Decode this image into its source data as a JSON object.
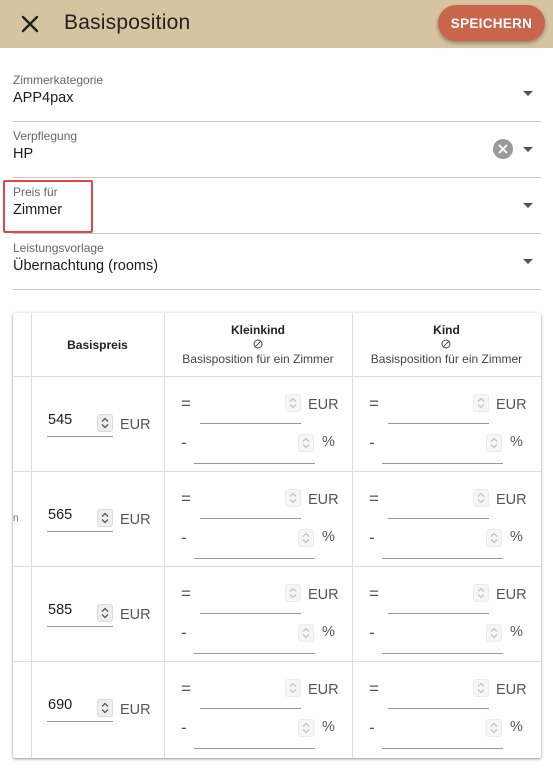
{
  "header": {
    "title": "Basisposition",
    "save_label": "SPEICHERN"
  },
  "fields": [
    {
      "label": "Zimmerkategorie",
      "value": "APP4pax"
    },
    {
      "label": "Verpflegung",
      "value": "HP"
    },
    {
      "label": "Preis für",
      "value": "Zimmer"
    },
    {
      "label": "Leistungsvorlage",
      "value": "Übernachtung (rooms)"
    }
  ],
  "table": {
    "col_basispreis": "Basispreis",
    "col_kleinkind": "Kleinkind",
    "col_kind": "Kind",
    "col_sub": "Basisposition für ein Zimmer",
    "unit_eur": "EUR",
    "unit_percent": "%",
    "op_equal": "=",
    "op_minus": "-",
    "cut_text": "n",
    "rows": [
      {
        "price": "545"
      },
      {
        "price": "565"
      },
      {
        "price": "585"
      },
      {
        "price": "690"
      }
    ]
  },
  "colors": {
    "header_bg": "#d6c4a0",
    "save_button": "#c9654a",
    "highlight_border": "#e04848"
  }
}
